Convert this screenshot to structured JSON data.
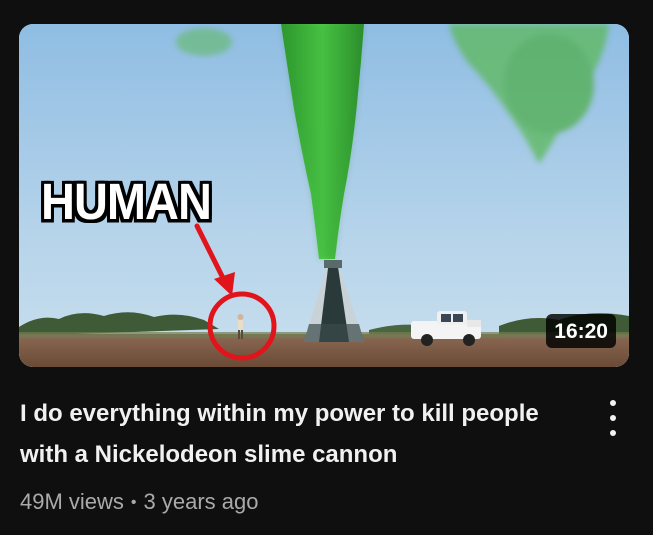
{
  "thumbnail": {
    "overlay_text": "HUMAN",
    "duration": "16:20",
    "colors": {
      "sky": "#a7cbe6",
      "slime": "#3bbf3b",
      "ground": "#7a5a45",
      "circle": "#e0141a"
    }
  },
  "video": {
    "title": "I do everything within my power to kill people with a Nickelodeon slime cannon",
    "views": "49M views",
    "separator": "•",
    "age": "3 years ago"
  },
  "icons": {
    "menu": "more-vert-icon"
  }
}
